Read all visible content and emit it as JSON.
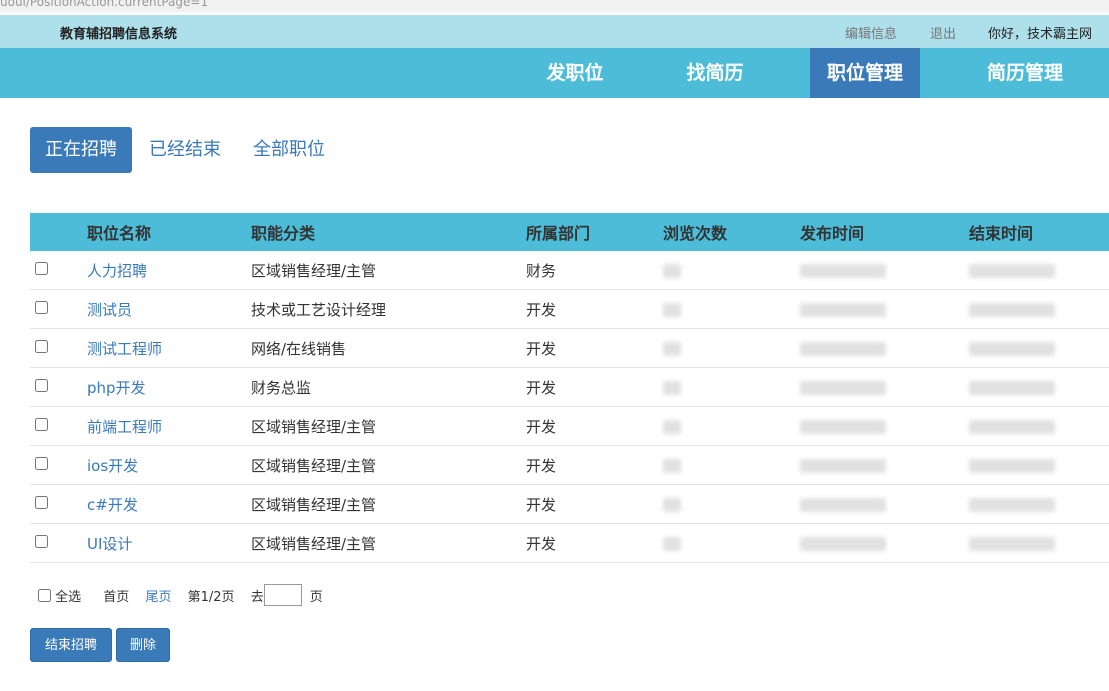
{
  "browser": {
    "url_fragment": "uoui/PositionAction.currentPage=1"
  },
  "topbar": {
    "title": "教育辅招聘信息系统",
    "edit_info": "编辑信息",
    "logout": "退出",
    "greeting": "你好，技术霸主网"
  },
  "nav": {
    "items": [
      {
        "label": "发职位"
      },
      {
        "label": "找简历"
      },
      {
        "label": "职位管理",
        "active": true
      },
      {
        "label": "简历管理"
      }
    ]
  },
  "subtabs": [
    {
      "label": "正在招聘",
      "active": true
    },
    {
      "label": "已经结束"
    },
    {
      "label": "全部职位"
    }
  ],
  "table": {
    "headers": [
      "职位名称",
      "职能分类",
      "所属部门",
      "浏览次数",
      "发布时间",
      "结束时间"
    ],
    "rows": [
      {
        "name": "人力招聘",
        "category": "区域销售经理/主管",
        "dept": "财务"
      },
      {
        "name": "测试员",
        "category": "技术或工艺设计经理",
        "dept": "开发"
      },
      {
        "name": "测试工程师",
        "category": "网络/在线销售",
        "dept": "开发"
      },
      {
        "name": "php开发",
        "category": "财务总监",
        "dept": "开发"
      },
      {
        "name": "前端工程师",
        "category": "区域销售经理/主管",
        "dept": "开发"
      },
      {
        "name": "ios开发",
        "category": "区域销售经理/主管",
        "dept": "开发"
      },
      {
        "name": "c#开发",
        "category": "区域销售经理/主管",
        "dept": "开发"
      },
      {
        "name": "UI设计",
        "category": "区域销售经理/主管",
        "dept": "开发"
      }
    ]
  },
  "pager": {
    "select_all": "全选",
    "first": "首页",
    "last": "尾页",
    "page_info": "第1/2页",
    "goto_prefix": "去",
    "goto_suffix": "页",
    "goto_value": ""
  },
  "actions": {
    "end_recruit": "结束招聘",
    "delete": "删除"
  },
  "colors": {
    "topbar_bg": "#aee0ec",
    "nav_bg": "#4dbcd8",
    "accent": "#3a7ab8"
  }
}
